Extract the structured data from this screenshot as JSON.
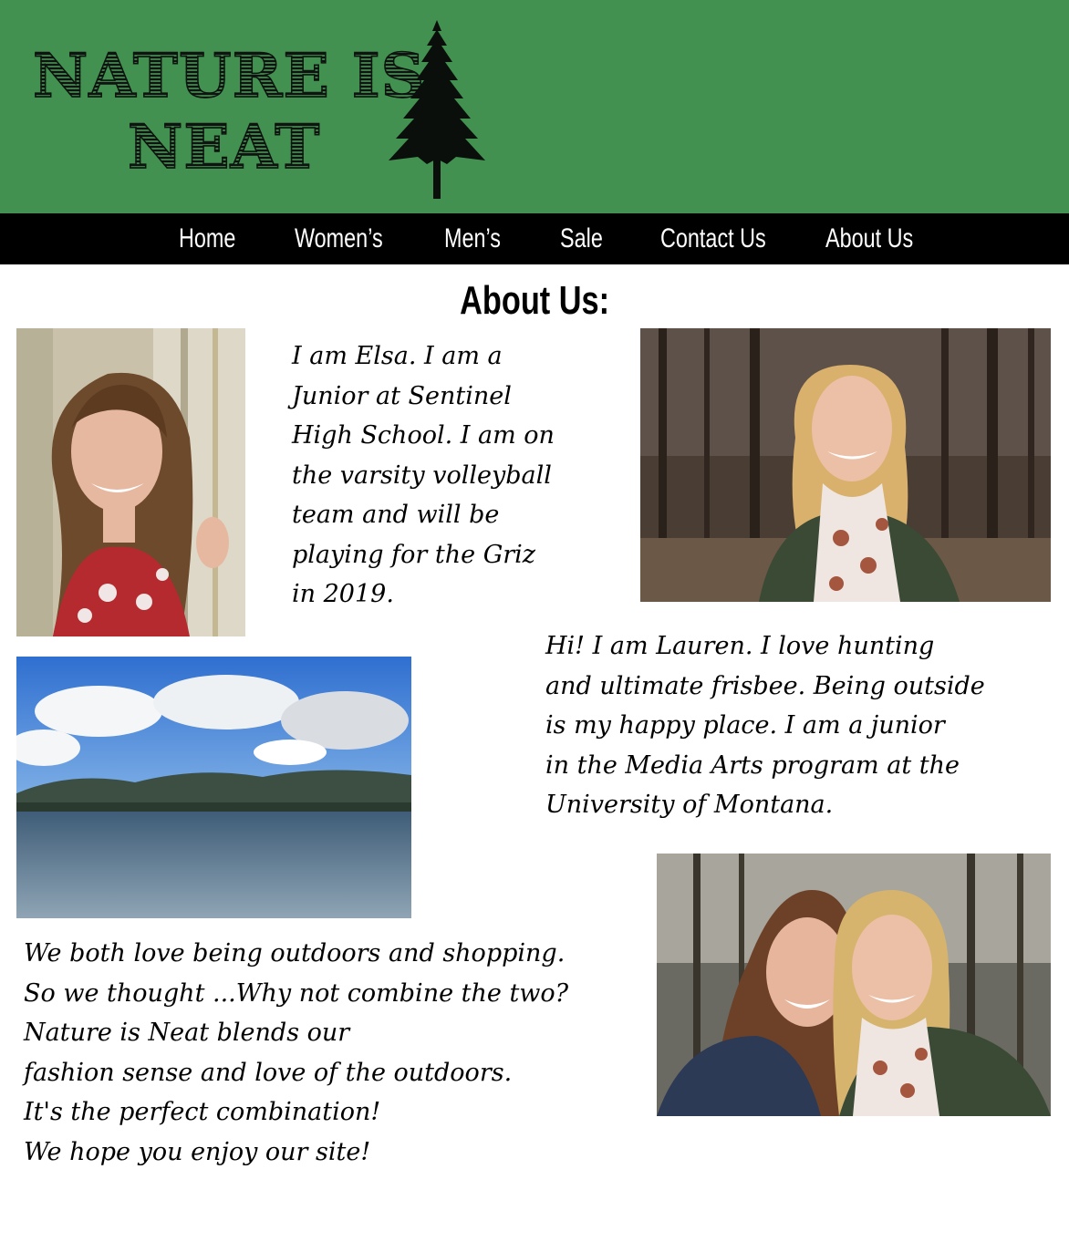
{
  "site": {
    "logo_line1": "NATURE IS",
    "logo_line2": "NEAT",
    "brand_color": "#439150",
    "nav_color": "#000000"
  },
  "nav": {
    "items": [
      {
        "label": "Home"
      },
      {
        "label": "Women’s"
      },
      {
        "label": "Men’s"
      },
      {
        "label": "Sale"
      },
      {
        "label": "Contact Us"
      },
      {
        "label": "About Us"
      }
    ]
  },
  "about": {
    "title": "About Us:",
    "elsa_text": "I am Elsa. I am a\nJunior at Sentinel\nHigh School. I am on\nthe varsity volleyball\nteam and will be\nplaying for the Griz\nin 2019.",
    "lauren_text": "Hi! I am Lauren. I love hunting\nand ultimate frisbee. Being outside\nis my happy place. I am a junior\nin the Media Arts program at the\nUniversity of Montana.",
    "closing_text": "We both love being outdoors and shopping.\nSo we thought ...Why not combine the two?\nNature is Neat blends our\nfashion sense and love of the outdoors.\nIt's the perfect combination!\nWe hope you enjoy our site!"
  },
  "icons": [
    "pine-tree-icon"
  ]
}
